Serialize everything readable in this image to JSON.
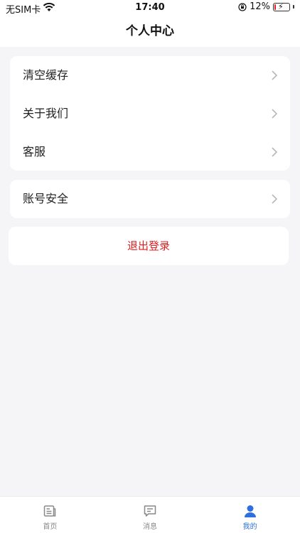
{
  "status_bar": {
    "carrier": "无SIM卡",
    "time": "17:40",
    "battery_percent": "12%",
    "battery_level": 0.12,
    "icons": [
      "wifi-icon",
      "orientation-lock-icon",
      "battery-charging-icon"
    ]
  },
  "header": {
    "title": "个人中心"
  },
  "menu_group1": [
    {
      "label": "清空缓存"
    },
    {
      "label": "关于我们"
    },
    {
      "label": "客服"
    }
  ],
  "menu_group2": [
    {
      "label": "账号安全"
    }
  ],
  "logout": {
    "label": "退出登录",
    "color": "#e02020"
  },
  "tab_bar": {
    "items": [
      {
        "label": "首页",
        "icon": "home-document-icon",
        "active": false
      },
      {
        "label": "消息",
        "icon": "message-icon",
        "active": false
      },
      {
        "label": "我的",
        "icon": "profile-icon",
        "active": true
      }
    ],
    "active_color": "#2f6fe0",
    "inactive_color": "#888888"
  }
}
